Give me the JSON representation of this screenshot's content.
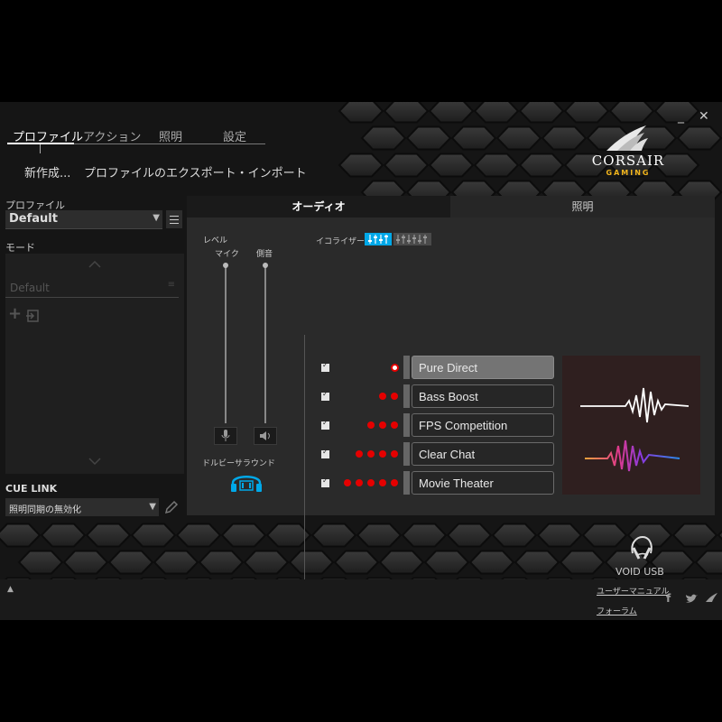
{
  "window": {
    "minimize_label": "_",
    "close_label": "✕"
  },
  "nav": {
    "tabs": [
      {
        "label": "プロファイル"
      },
      {
        "label": "アクション"
      },
      {
        "label": "照明"
      },
      {
        "label": "設定"
      }
    ],
    "sub": {
      "new_label": "新作成...",
      "export_label": "プロファイルのエクスポート・インポート"
    }
  },
  "brand": {
    "name": "CORSAIR",
    "sub": "GAMING",
    "accent": "#f2b51d"
  },
  "left": {
    "profile_label": "プロファイル",
    "profile_value": "Default",
    "mode_label": "モード",
    "mode_item": "Default",
    "cue_link_label": "CUE LINK",
    "cue_link_value": "照明同期の無効化"
  },
  "main": {
    "tabs": [
      {
        "label": "オーディオ"
      },
      {
        "label": "照明"
      }
    ],
    "level_label": "レベル",
    "mic_label": "マイク",
    "sidetone_label": "側音",
    "dolby_label": "ドルビーサラウンド",
    "eq_label": "イコライザー",
    "presets": [
      {
        "name": "Pure Direct",
        "dots": 1,
        "selected": true
      },
      {
        "name": "Bass Boost",
        "dots": 2,
        "selected": false
      },
      {
        "name": "FPS Competition",
        "dots": 3,
        "selected": false
      },
      {
        "name": "Clear Chat",
        "dots": 4,
        "selected": false
      },
      {
        "name": "Movie Theater",
        "dots": 5,
        "selected": false
      }
    ],
    "accent": "#00a8e8",
    "dot_color": "#e50000"
  },
  "device": {
    "name": "VOID USB"
  },
  "footer": {
    "manual_label": "ユーザーマニュアル",
    "forum_label": "フォーラム",
    "expand_label": "▲",
    "icons": [
      "facebook-icon",
      "twitter-icon",
      "corsair-icon"
    ]
  }
}
